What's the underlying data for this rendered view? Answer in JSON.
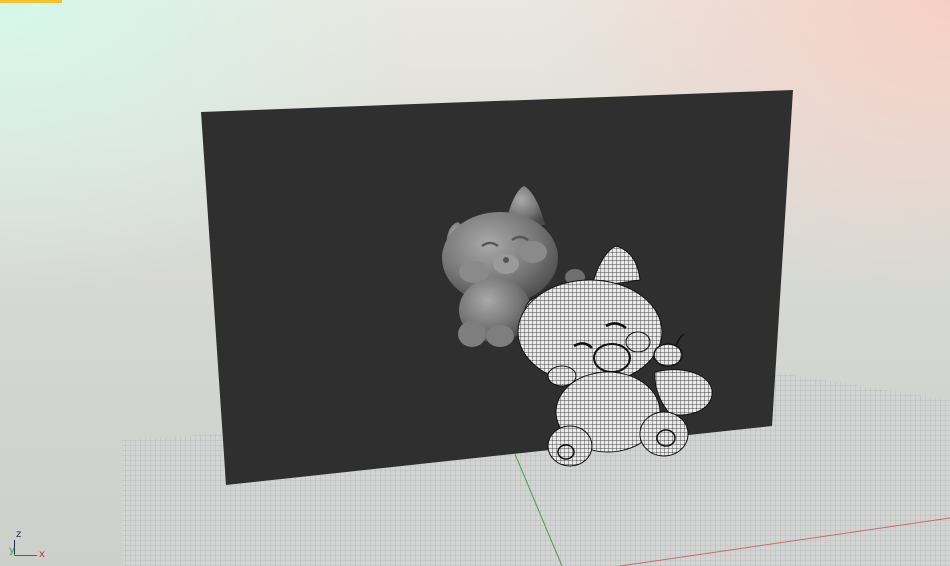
{
  "viewport": {
    "background": "gradient",
    "active_tab_color": "#f2c230"
  },
  "scene": {
    "backdrop_color": "#2f2f2f",
    "floor_grid_color": "#b9bcbc",
    "objects": [
      {
        "name": "bear-sculpt-smooth",
        "style": "smooth shaded gray"
      },
      {
        "name": "bear-sculpt-wireframe",
        "style": "wireframe mesh"
      }
    ]
  },
  "axis_gizmo": {
    "z": "z",
    "y": "y",
    "x": "x",
    "x_color": "#d22b2b",
    "y_color": "#3f9d3f",
    "z_color": "#1b2a5a"
  }
}
